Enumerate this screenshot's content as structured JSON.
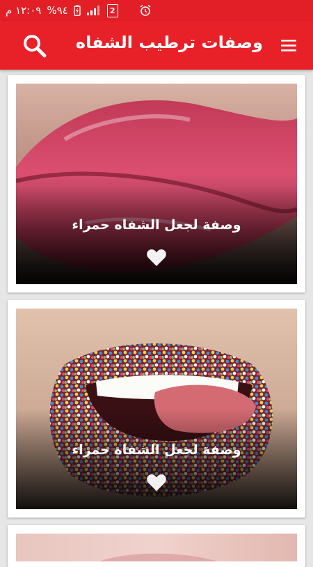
{
  "status_bar": {
    "time": "١٢:٠٩ م",
    "battery": "%٩٤",
    "sim_slot": "2",
    "alarm_icon": "alarm-clock-icon",
    "signal_icon": "signal-bars-icon",
    "battery_icon": "battery-charging-icon"
  },
  "app_bar": {
    "title": "وصفات ترطيب الشفاه",
    "menu_icon": "hamburger-menu-icon",
    "search_icon": "search-icon",
    "color": "#e82027"
  },
  "cards": [
    {
      "title": "وصفة لجعل الشفاه حمراء",
      "image": "glossy-red-lips",
      "favorite_icon": "heart-icon"
    },
    {
      "title": "وصفة لجعل الشفاه حمراء",
      "image": "sprinkle-candy-lips",
      "favorite_icon": "heart-icon"
    },
    {
      "title": "",
      "image": "pink-lips-partial"
    }
  ]
}
